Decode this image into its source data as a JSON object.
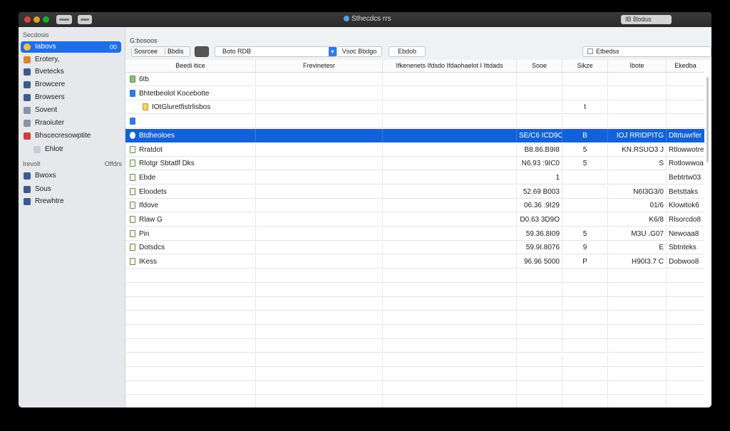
{
  "window": {
    "title": "Sthecdcs rrs",
    "right_field": "IB Bbdus",
    "toolbar_left_buttons": [
      "view-toggle",
      "sidebar-toggle"
    ]
  },
  "sidebar": {
    "section1": "Secdosis",
    "items1": [
      {
        "label": "Iabovs",
        "badge": "00",
        "icon": "badge-icon",
        "selected": true
      },
      {
        "label": "Erotery,",
        "icon": "orange-folder-icon"
      },
      {
        "label": "Bvetecks",
        "icon": "book-icon"
      },
      {
        "label": "Browcere",
        "icon": "book-icon"
      },
      {
        "label": "Browsers",
        "icon": "chart-icon"
      },
      {
        "label": "Sovent",
        "icon": "doc-icon"
      },
      {
        "label": "Rraoiuter",
        "icon": "doc-icon"
      },
      {
        "label": "Bhscecresowptite",
        "icon": "red-icon"
      },
      {
        "label": "Ehlotr",
        "icon": "small-icon"
      }
    ],
    "section2": "Irevolt",
    "section2_right": "Offdrs",
    "items2": [
      {
        "label": "Bwoxs",
        "icon": "doc-icon"
      },
      {
        "label": "Sous",
        "icon": "doc-icon"
      },
      {
        "label": "Rrewhtre",
        "icon": "doc-icon"
      }
    ]
  },
  "toolbar": {
    "path_label": "G:bosoos",
    "seg_left": "Sosrcee",
    "seg_right": "Bbdis",
    "combo_value": "Boto RDB",
    "button1": "Vsoc Bbdgo",
    "button2": "Ebdob",
    "search_placeholder": "Etbedss"
  },
  "table": {
    "headers": [
      "Beedi itice",
      "Frevinetesr",
      "Ifkenenets Ifdsdo Ifdaohaelot I Ittdads",
      "Sooe",
      "Sikze",
      "Ibote",
      "Ekedba"
    ],
    "rows": [
      {
        "name": "6tb",
        "indent": 0,
        "icon": "sq",
        "size": "",
        "kind": "",
        "date": "",
        "extra": "",
        "last": ""
      },
      {
        "name": "Bhtetbeolot Kocebotte",
        "indent": 0,
        "icon": "blue",
        "size": "",
        "kind": "",
        "date": "",
        "extra": "",
        "last": ""
      },
      {
        "name": "IOtGluretfistrlisbos",
        "indent": 1,
        "icon": "gold",
        "size": "",
        "kind": "",
        "date": "t",
        "extra": "",
        "last": ""
      },
      {
        "name": "",
        "indent": 0,
        "icon": "blue",
        "size": "",
        "kind": "",
        "date": "",
        "extra": "",
        "last": ""
      },
      {
        "name": "Btdheoloes",
        "indent": 0,
        "icon": "pink",
        "size": "SE/C6 ICD9O",
        "kind": "",
        "date": "B",
        "extra": "IOJ RRIDPITG",
        "last": "Dltrtuwrfer",
        "selected": true
      },
      {
        "name": "Rratdot",
        "indent": 0,
        "icon": "",
        "size": "B8.86.B9I8",
        "kind": "",
        "date": "5",
        "extra": "KN.RSUO3 J",
        "last": "Rtlowwotre"
      },
      {
        "name": "Rlotgr Sbtatlf Dks",
        "indent": 0,
        "icon": "",
        "size": "N6.93 :9IC0",
        "kind": "",
        "date": "5",
        "extra": "S",
        "last": "Rotlowwoa"
      },
      {
        "name": "Ebde",
        "indent": 0,
        "icon": "",
        "size": "1",
        "kind": "",
        "date": "",
        "extra": "",
        "last": "Bebtrtw03"
      },
      {
        "name": "Eloodets",
        "indent": 0,
        "icon": "",
        "size": "52.69 B003",
        "kind": "",
        "date": "",
        "extra": "N6I3G3/0",
        "last": "Betsttaks"
      },
      {
        "name": "Ifdove",
        "indent": 0,
        "icon": "",
        "size": "06.36 :9I29",
        "kind": "",
        "date": "",
        "extra": "01/6",
        "last": "Klowitok6"
      },
      {
        "name": "Rlaw G",
        "indent": 0,
        "icon": "",
        "size": "D0.63 3D9O",
        "kind": "",
        "date": "",
        "extra": "K6/8",
        "last": "Rlsorcdo8"
      },
      {
        "name": "Pin",
        "indent": 0,
        "icon": "",
        "size": "59.36.8I09",
        "kind": "",
        "date": "5",
        "extra": "M3U .G07",
        "last": "Newoaa8"
      },
      {
        "name": "Dotsdcs",
        "indent": 0,
        "icon": "",
        "size": "59.9I.8076",
        "kind": "",
        "date": "9",
        "extra": "E",
        "last": "Sbtnteks"
      },
      {
        "name": "IKess",
        "indent": 0,
        "icon": "",
        "size": "96.96 5000",
        "kind": "",
        "date": "P",
        "extra": "H90I3.7 C",
        "last": "Dobwoo8"
      }
    ]
  }
}
